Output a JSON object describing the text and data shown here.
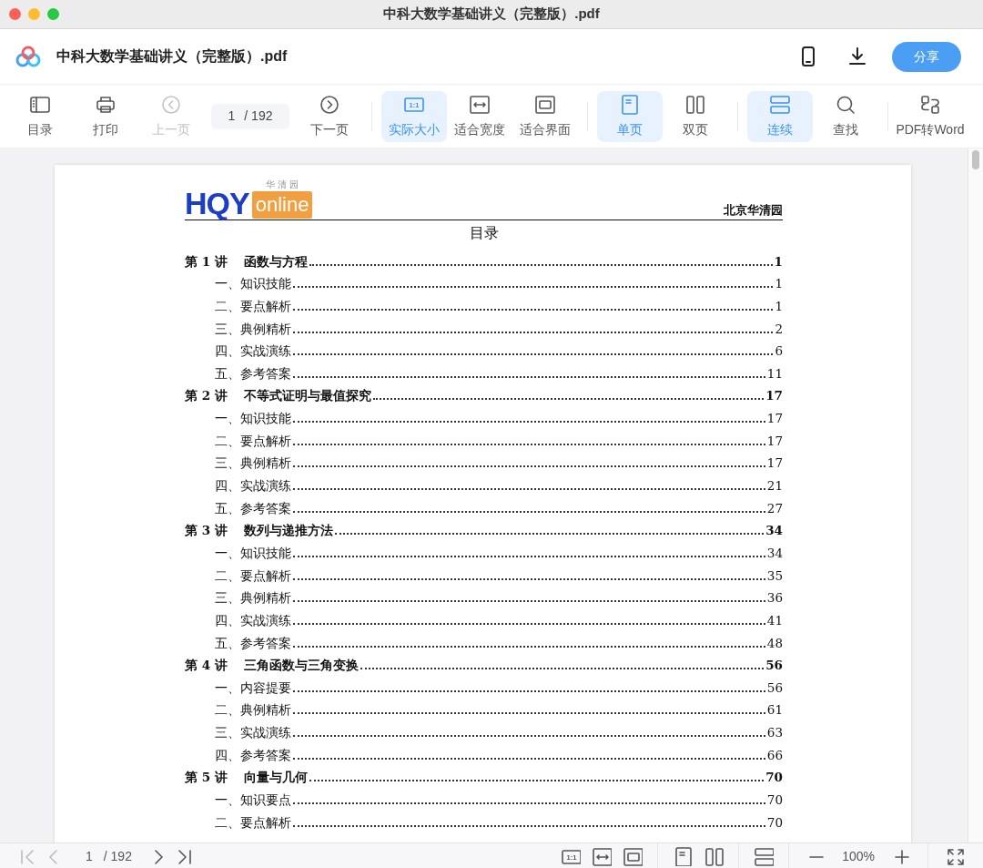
{
  "window": {
    "title": "中科大数学基础讲义（完整版）.pdf"
  },
  "header": {
    "file_name": "中科大数学基础讲义（完整版）.pdf",
    "share_label": "分享"
  },
  "toolbar": {
    "groups": [
      [
        {
          "kind": "button",
          "label": "目录",
          "disabled": false
        },
        {
          "kind": "button",
          "label": "打印",
          "disabled": false
        },
        {
          "kind": "button",
          "label": "上一页",
          "disabled": true
        },
        {
          "kind": "page-input",
          "value": "1",
          "total": "/  192"
        },
        {
          "kind": "button",
          "label": "下一页",
          "disabled": false
        }
      ],
      [
        {
          "kind": "button",
          "label": "实际大小",
          "icon_text": "1:1",
          "selected": true
        },
        {
          "kind": "button",
          "label": "适合宽度",
          "selected": false
        },
        {
          "kind": "button",
          "label": "适合界面",
          "selected": false
        }
      ],
      [
        {
          "kind": "button",
          "label": "单页",
          "selected": true
        },
        {
          "kind": "button",
          "label": "双页",
          "selected": false
        }
      ],
      [
        {
          "kind": "button",
          "label": "连续",
          "selected": true
        },
        {
          "kind": "button",
          "label": "查找",
          "selected": false
        }
      ],
      [
        {
          "kind": "button",
          "label": "PDF转Word",
          "selected": false
        }
      ]
    ]
  },
  "document": {
    "logo": {
      "tagline": "华 清 园",
      "mark": "HQY",
      "word": "online"
    },
    "brand": "北京华清园",
    "toc_title": "目录",
    "chapters": [
      {
        "number": "第 1 讲",
        "title": "函数与方程",
        "page": "1",
        "children": [
          {
            "title": "一、知识技能",
            "page": "1"
          },
          {
            "title": "二、要点解析",
            "page": "1"
          },
          {
            "title": "三、典例精析",
            "page": "2"
          },
          {
            "title": "四、实战演练",
            "page": "6"
          },
          {
            "title": "五、参考答案",
            "page": "11"
          }
        ]
      },
      {
        "number": "第 2 讲",
        "title": "不等式证明与最值探究",
        "page": "17",
        "children": [
          {
            "title": "一、知识技能",
            "page": "17"
          },
          {
            "title": "二、要点解析",
            "page": "17"
          },
          {
            "title": "三、典例精析",
            "page": "17"
          },
          {
            "title": "四、实战演练",
            "page": "21"
          },
          {
            "title": "五、参考答案",
            "page": "27"
          }
        ]
      },
      {
        "number": "第 3 讲",
        "title": "数列与递推方法",
        "page": "34",
        "children": [
          {
            "title": "一、知识技能",
            "page": "34"
          },
          {
            "title": "二、要点解析",
            "page": "35"
          },
          {
            "title": "三、典例精析",
            "page": "36"
          },
          {
            "title": "四、实战演练",
            "page": "41"
          },
          {
            "title": "五、参考答案",
            "page": "48"
          }
        ]
      },
      {
        "number": "第 4 讲",
        "title": "三角函数与三角变换",
        "page": "56",
        "children": [
          {
            "title": "一、内容提要",
            "page": "56"
          },
          {
            "title": "二、典例精析",
            "page": "61"
          },
          {
            "title": "三、实战演练",
            "page": "63"
          },
          {
            "title": "四、参考答案",
            "page": "66"
          }
        ]
      },
      {
        "number": "第 5 讲",
        "title": "向量与几何",
        "page": "70",
        "children": [
          {
            "title": "一、知识要点",
            "page": "70"
          },
          {
            "title": "二、要点解析",
            "page": "70"
          }
        ]
      }
    ]
  },
  "bottom_bar": {
    "nav_buttons": [
      {
        "disabled": true
      },
      {
        "disabled": true
      },
      {
        "disabled": false
      },
      {
        "disabled": false
      }
    ],
    "page": "1",
    "total": "/ 192",
    "zoom": "100%",
    "actual_size_icon_text": "1:1"
  }
}
